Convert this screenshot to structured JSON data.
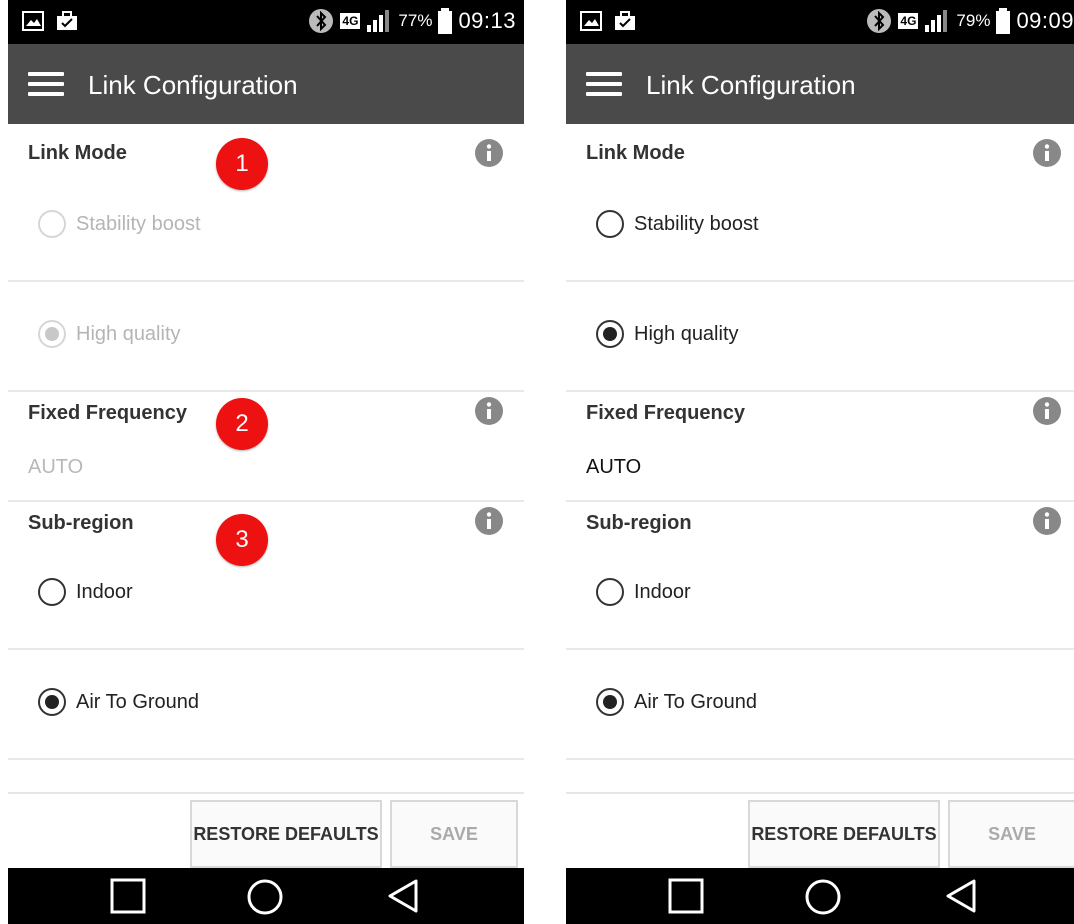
{
  "screens": [
    {
      "status": {
        "battery": "77%",
        "time": "09:13",
        "network": "4G"
      },
      "app_title": "Link Configuration",
      "link_mode": {
        "title": "Link Mode",
        "options": [
          "Stability boost",
          "High quality"
        ],
        "selected": "High quality",
        "enabled": false
      },
      "fixed_frequency": {
        "title": "Fixed Frequency",
        "value": "AUTO",
        "enabled": false
      },
      "sub_region": {
        "title": "Sub-region",
        "options": [
          "Indoor",
          "Air To Ground"
        ],
        "selected": "Air To Ground"
      },
      "badges": [
        "1",
        "2",
        "3"
      ],
      "buttons": {
        "restore": "RESTORE DEFAULTS",
        "save": "SAVE"
      }
    },
    {
      "status": {
        "battery": "79%",
        "time": "09:09",
        "network": "4G"
      },
      "app_title": "Link Configuration",
      "link_mode": {
        "title": "Link Mode",
        "options": [
          "Stability boost",
          "High quality"
        ],
        "selected": "High quality",
        "enabled": true
      },
      "fixed_frequency": {
        "title": "Fixed Frequency",
        "value": "AUTO",
        "enabled": true
      },
      "sub_region": {
        "title": "Sub-region",
        "options": [
          "Indoor",
          "Air To Ground"
        ],
        "selected": "Air To Ground"
      },
      "buttons": {
        "restore": "RESTORE DEFAULTS",
        "save": "SAVE"
      }
    }
  ],
  "colors": {
    "appbar": "#4a4a4a",
    "badge": "#ee1111",
    "statusbar": "#000000"
  },
  "icons": [
    "image-icon",
    "bag-icon",
    "bluetooth-icon",
    "signal-icon",
    "battery-icon",
    "hamburger-menu-icon",
    "info-icon",
    "square-nav-icon",
    "circle-nav-icon",
    "back-nav-icon"
  ]
}
